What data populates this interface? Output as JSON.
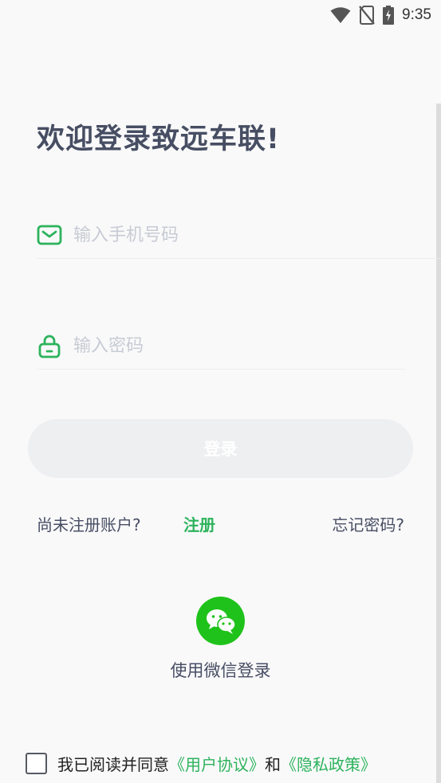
{
  "status_bar": {
    "time": "9:35",
    "icons": [
      "wifi-icon",
      "no-sim-icon",
      "battery-charging-icon"
    ]
  },
  "welcome_title": "欢迎登录致远车联!",
  "phone_field": {
    "placeholder": "输入手机号码",
    "value": "",
    "icon": "envelope-icon"
  },
  "password_field": {
    "placeholder": "输入密码",
    "value": "",
    "icon": "lock-icon"
  },
  "login_button": {
    "label": "登录",
    "enabled": false
  },
  "links": {
    "no_account": "尚未注册账户?",
    "register": "注册",
    "forgot_password": "忘记密码?"
  },
  "wechat_login": {
    "icon": "wechat-icon",
    "label": "使用微信登录"
  },
  "agreement": {
    "checked": false,
    "prefix": "我已阅读并同意",
    "user_agreement": "《用户协议》",
    "and": "和",
    "privacy_policy": "《隐私政策》"
  },
  "colors": {
    "accent": "#2db35c",
    "wechat": "#1fc21a",
    "text_dark": "#474e63",
    "placeholder": "#c7cbd3",
    "background": "#f9f9fa"
  }
}
